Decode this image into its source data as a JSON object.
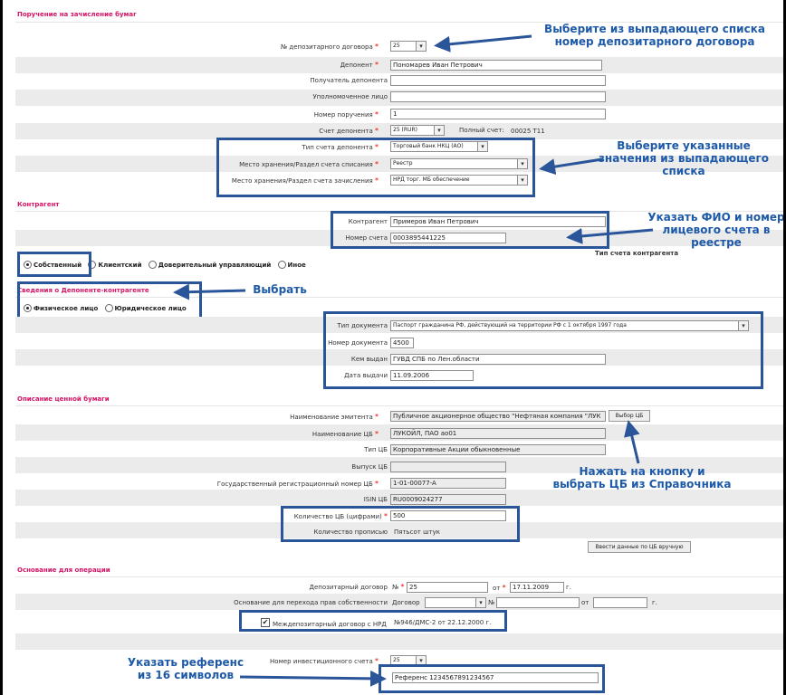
{
  "order": {
    "title": "Поручение на зачисление бумаг",
    "contract_no_label": "№ депозитарного договора",
    "contract_no_value": "25",
    "deponent_label": "Депонент",
    "deponent_value": "Пономарев Иван Петрович",
    "recipient_label": "Получатель депонента",
    "recipient_value": "",
    "authorized_label": "Уполномоченное лицо",
    "authorized_value": "",
    "order_no_label": "Номер поручения",
    "order_no_value": "1",
    "account_label": "Счет депонента",
    "account_value": "25 (RUR)",
    "full_account_label": "Полный счет:",
    "full_account_value": "00025 T11",
    "account_type_label": "Тип счета депонента",
    "account_type_value": "Торговый банк НКЦ (АО)",
    "debit_place_label": "Место хранения/Раздел счета списания",
    "debit_place_value": "Реестр",
    "credit_place_label": "Место хранения/Раздел счета зачисления",
    "credit_place_value": "НРД торг. МБ обеспечение"
  },
  "counterparty": {
    "title": "Контрагент",
    "name_label": "Контрагент",
    "name_value": "Примеров Иван Петрович",
    "account_no_label": "Номер счета",
    "account_no_value": "0003895441225",
    "account_type_caption": "Тип счета контрагента",
    "account_types": [
      "Собственный",
      "Клиентский",
      "Доверительный управляющий",
      "Иное"
    ]
  },
  "deponent_info": {
    "title": "Сведения о Депоненте-контрагенте",
    "person_types": [
      "Физическое лицо",
      "Юридическое лицо"
    ],
    "doc_type_label": "Тип документа",
    "doc_type_value": "Паспорт гражданина РФ, действующий на территории РФ с 1 октября 1997 года",
    "doc_no_label": "Номер документа",
    "doc_no_value": "4500",
    "issued_by_label": "Кем выдан",
    "issued_by_value": "ГУВД СПБ по Лен.области",
    "issue_date_label": "Дата выдачи",
    "issue_date_value": "11.09.2006"
  },
  "security": {
    "title": "Описание ценной бумаги",
    "issuer_label": "Наименование эмитента",
    "issuer_value": "Публичное акционерное общество \"Нефтяная компания \"ЛУК",
    "select_button": "Выбор ЦБ",
    "name_label": "Наименование ЦБ",
    "name_value": "ЛУКОЙЛ, ПАО ао01",
    "type_label": "Тип ЦБ",
    "type_value": "Корпоративные Акции обыкновенные",
    "issue_label": "Выпуск ЦБ",
    "issue_value": "",
    "reg_no_label": "Государственный регистрационный номер ЦБ",
    "reg_no_value": "1-01-00077-A",
    "isin_label": "ISIN ЦБ",
    "isin_value": "RU0009024277",
    "qty_label": "Количество ЦБ (цифрами)",
    "qty_value": "500",
    "qty_words_label": "Количество прописью",
    "qty_words_value": "Пятьсот штук",
    "manual_button": "Ввести данные по ЦБ вручную"
  },
  "basis": {
    "title": "Основание для операции",
    "contract_label": "Депозитарный договор",
    "no_label": "№",
    "contract_no": "25",
    "from_label": "от",
    "contract_date": "17.11.2009",
    "year_suffix": "г.",
    "ownership_label": "Основание для перехода прав собственности",
    "ownership_value": "Договор",
    "ownership_no": "",
    "ownership_date": "",
    "interdep_label": "Междепозитарный договор с НРД",
    "interdep_value": "№946/ДМС-2 от  22.12.2000 г.",
    "invest_label": "Номер инвестиционного счета",
    "invest_value": "25",
    "reference_value": "Референс 1234567891234567"
  },
  "annotations": {
    "a1": "Выберите из выпадающего списка номер депозитарного договора",
    "a2": "Выберите указанные значения из выпадающего списка",
    "a3": "Указать ФИО и номер лицевого счета в реестре",
    "a4": "Выбрать",
    "a5": "Нажать на кнопку и выбрать ЦБ из Справочника",
    "a6": "Указать референс из 16 символов"
  },
  "colors": {
    "section_title": "#d51465",
    "annotation": "#1e5aa8",
    "required": "#e00000"
  }
}
